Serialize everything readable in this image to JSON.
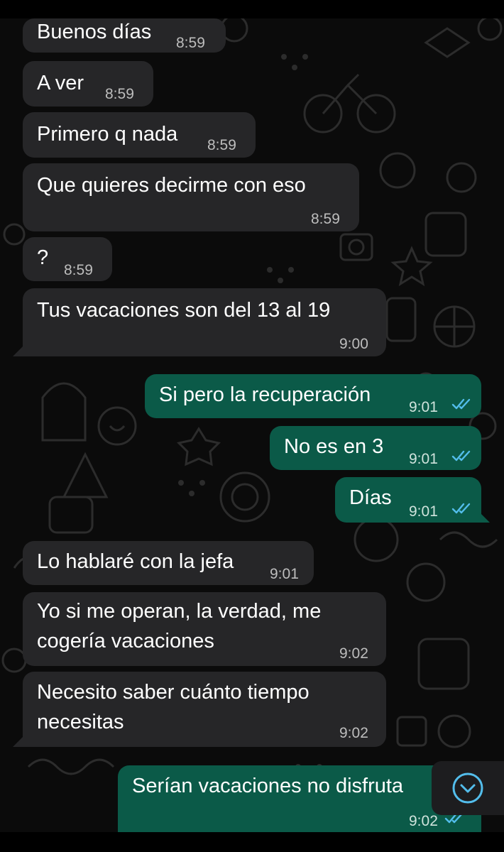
{
  "conversation": {
    "messages": [
      {
        "direction": "incoming",
        "text": "Buenos días",
        "time": "8:59"
      },
      {
        "direction": "incoming",
        "text": "A ver",
        "time": "8:59"
      },
      {
        "direction": "incoming",
        "text": "Primero q nada",
        "time": "8:59"
      },
      {
        "direction": "incoming",
        "text": "Que quieres decirme con eso",
        "time": "8:59"
      },
      {
        "direction": "incoming",
        "text": "?",
        "time": "8:59"
      },
      {
        "direction": "incoming",
        "text": "Tus vacaciones son del 13 al 19",
        "time": "9:00"
      },
      {
        "direction": "outgoing",
        "text": "Si pero la recuperación",
        "time": "9:01",
        "status": "read"
      },
      {
        "direction": "outgoing",
        "text": "No es en 3",
        "time": "9:01",
        "status": "read"
      },
      {
        "direction": "outgoing",
        "text": "Días",
        "time": "9:01",
        "status": "read"
      },
      {
        "direction": "incoming",
        "text": "Lo hablaré con la jefa",
        "time": "9:01"
      },
      {
        "direction": "incoming",
        "lines": [
          "Yo si me operan, la verdad, me",
          "cogería vacaciones"
        ],
        "time": "9:02"
      },
      {
        "direction": "incoming",
        "lines": [
          "Necesito saber cuánto tiempo",
          "necesitas"
        ],
        "time": "9:02"
      },
      {
        "direction": "outgoing",
        "text": "Serían vacaciones no disfruta",
        "time": "9:02",
        "status": "read"
      }
    ]
  },
  "colors": {
    "background": "#0b0b0b",
    "incoming_bubble": "#262628",
    "outgoing_bubble": "#0b5a48",
    "read_ticks": "#53bdeb"
  },
  "icons": {
    "read_receipt": "double-check-icon",
    "scroll_down": "chevron-down-circle-icon"
  }
}
